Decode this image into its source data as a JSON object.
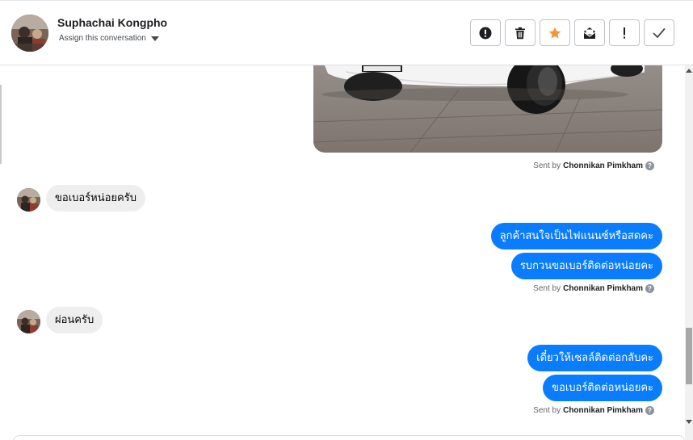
{
  "header": {
    "contact_name": "Suphachai Kongpho",
    "assign_label": "Assign this conversation",
    "actions": [
      {
        "name": "spam",
        "icon": "alert-circle-icon"
      },
      {
        "name": "delete",
        "icon": "trash-icon"
      },
      {
        "name": "star",
        "icon": "star-icon",
        "color": "#f7923b"
      },
      {
        "name": "mark-unread",
        "icon": "envelope-icon"
      },
      {
        "name": "follow-up",
        "icon": "exclamation-icon"
      },
      {
        "name": "done",
        "icon": "check-icon"
      }
    ]
  },
  "conversation": {
    "sent_by_prefix": "Sent by",
    "agent_name": "Chonnikan Pimkham",
    "help_glyph": "?",
    "incoming": [
      {
        "text": "ขอเบอร์หน่อยครับ"
      },
      {
        "text": "ผ่อนครับ"
      }
    ],
    "outgoing_group_1": [
      {
        "text": "ลูกค้าสนใจเป็นไฟแนนซ์หรือสดคะ"
      },
      {
        "text": "รบกวนขอเบอร์ติดต่อหน่อยคะ"
      }
    ],
    "outgoing_group_2": [
      {
        "text": "เดี๋ยวให้เซลล์ติดต่อกลับคะ"
      },
      {
        "text": "ขอเบอร์ติดต่อหน่อยคะ"
      }
    ]
  },
  "colors": {
    "outgoing_bubble": "#0a7cff",
    "incoming_bubble": "#eeeeef",
    "star": "#f7923b"
  }
}
